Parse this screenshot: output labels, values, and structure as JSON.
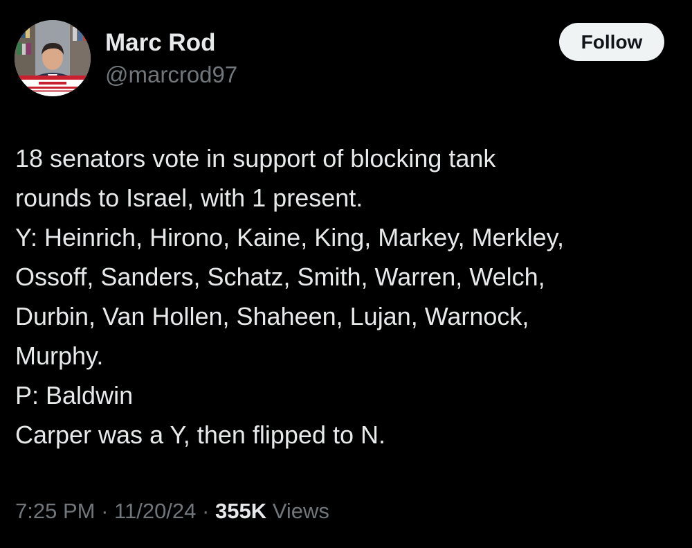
{
  "author": {
    "name": "Marc Rod",
    "handle": "@marcrod97"
  },
  "follow_button": {
    "label": "Follow"
  },
  "tweet": {
    "lines": [
      "18 senators vote in support of blocking tank",
      "rounds to Israel, with 1 present.",
      "Y: Heinrich, Hirono, Kaine, King, Markey, Merkley,",
      "Ossoff, Sanders, Schatz, Smith, Warren, Welch,",
      "Durbin, Van Hollen, Shaheen, Lujan, Warnock,",
      "Murphy.",
      "P: Baldwin",
      "Carper was a Y, then flipped to N."
    ]
  },
  "meta": {
    "time": "7:25 PM",
    "separator": "·",
    "date": "11/20/24",
    "views_count": "355K",
    "views_label": "Views"
  },
  "colors": {
    "background": "#000000",
    "text_primary": "#e7e9ea",
    "text_secondary": "#71767b",
    "follow_bg": "#eff3f4",
    "follow_text": "#0f1419"
  }
}
